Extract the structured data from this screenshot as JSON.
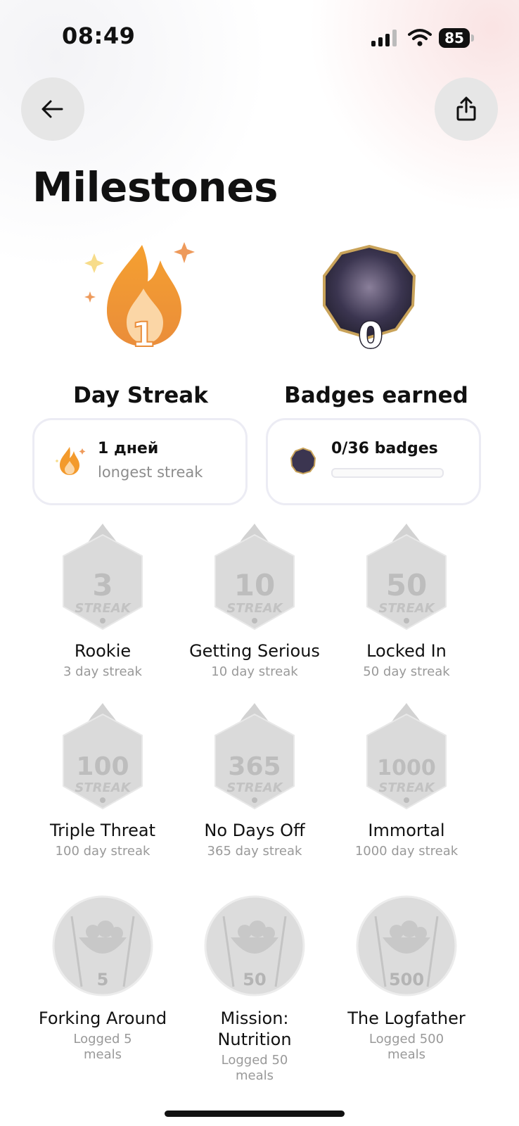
{
  "status": {
    "time": "08:49",
    "battery": "85"
  },
  "header": {
    "back_icon": "arrow-left-icon",
    "share_icon": "share-icon"
  },
  "page": {
    "title": "Milestones"
  },
  "stats": {
    "streak_count": "1",
    "streak_label": "Day Streak",
    "badges_count": "0",
    "badges_label": "Badges earned"
  },
  "cards": {
    "streak_title": "1 дней",
    "streak_sub": "longest streak",
    "badges_title": "0/36 badges",
    "badges_progress": 0.0
  },
  "badges": [
    {
      "name": "Rookie",
      "desc": "3 day streak",
      "number": "3",
      "word": "STREAK"
    },
    {
      "name": "Getting Serious",
      "desc": "10 day streak",
      "number": "10",
      "word": "STREAK"
    },
    {
      "name": "Locked In",
      "desc": "50 day streak",
      "number": "50",
      "word": "STREAK"
    },
    {
      "name": "Triple Threat",
      "desc": "100 day streak",
      "number": "100",
      "word": "STREAK"
    },
    {
      "name": "No Days Off",
      "desc": "365 day streak",
      "number": "365",
      "word": "STREAK"
    },
    {
      "name": "Immortal",
      "desc": "1000 day streak",
      "number": "1000",
      "word": "STREAK"
    },
    {
      "name": "Forking Around",
      "desc": "Logged 5 meals",
      "number": "5"
    },
    {
      "name": "Mission: Nutrition",
      "desc": "Logged 50 meals",
      "number": "50"
    },
    {
      "name": "The Logfather",
      "desc": "Logged 500 meals",
      "number": "500"
    }
  ],
  "colors": {
    "flame": "#f39a2c",
    "badge_dark": "#3b3550",
    "badge_gold": "#c9a35a",
    "locked_gray": "#d9d9d9"
  }
}
